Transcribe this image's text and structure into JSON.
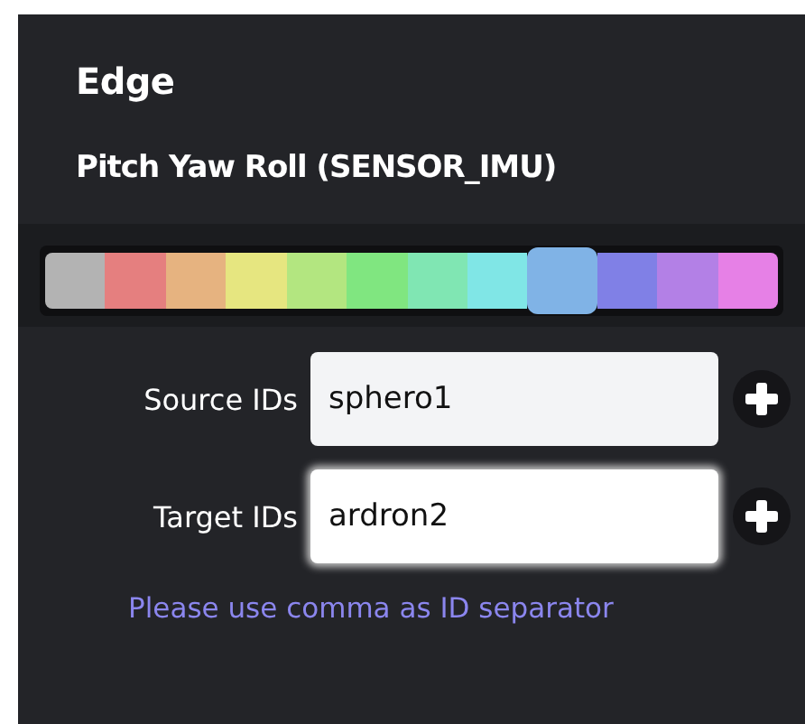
{
  "panel": {
    "title": "Edge",
    "subtitle": "Pitch Yaw Roll (SENSOR_IMU)"
  },
  "palette": [
    {
      "color": "#b3b3b3",
      "selected": false
    },
    {
      "color": "#e57f7f",
      "selected": false
    },
    {
      "color": "#e6b380",
      "selected": false
    },
    {
      "color": "#e6e680",
      "selected": false
    },
    {
      "color": "#b3e680",
      "selected": false
    },
    {
      "color": "#80e680",
      "selected": false
    },
    {
      "color": "#80e6b3",
      "selected": false
    },
    {
      "color": "#80e6e6",
      "selected": false
    },
    {
      "color": "#80b3e6",
      "selected": true
    },
    {
      "color": "#8080e6",
      "selected": false
    },
    {
      "color": "#b380e6",
      "selected": false
    },
    {
      "color": "#e680e6",
      "selected": false
    }
  ],
  "fields": [
    {
      "label": "Source IDs",
      "value": "sphero1",
      "focused": false
    },
    {
      "label": "Target IDs",
      "value": "ardron2",
      "focused": true
    }
  ],
  "hint": "Please use comma as ID separator"
}
